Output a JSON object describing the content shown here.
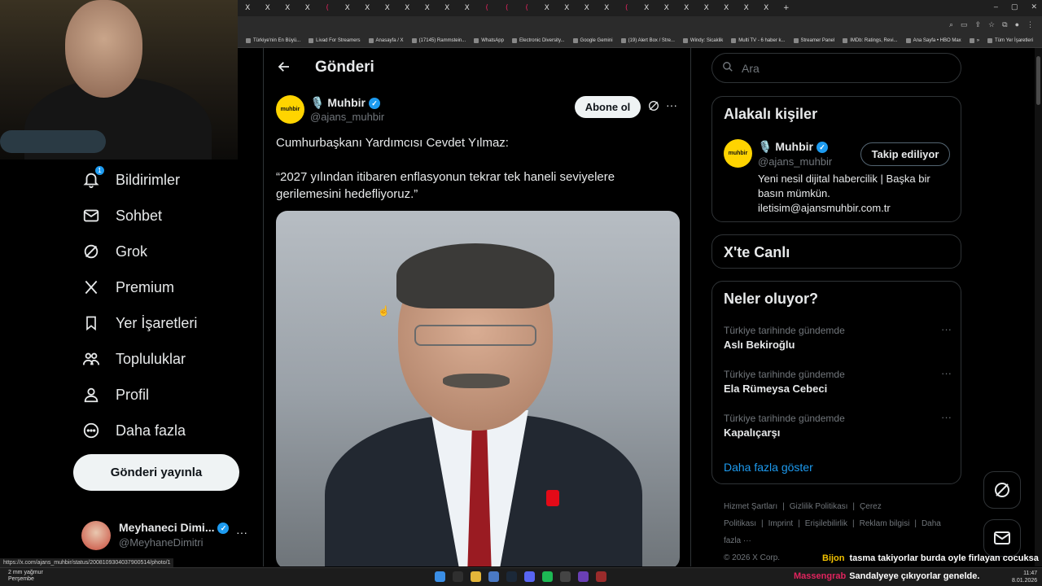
{
  "browser": {
    "tabs": [
      "X",
      "X",
      "X",
      "X",
      "(",
      "X",
      "X",
      "X",
      "X",
      "X",
      "X",
      "X",
      "(",
      "(",
      "(",
      "X",
      "X",
      "X",
      "X",
      "(",
      "X",
      "X",
      "X",
      "X",
      "X",
      "X",
      "X"
    ],
    "new_tab": "+",
    "bookmarks": [
      "Türkiye'nin En Büyü...",
      "Livad For Streamers",
      "Anasayfa / X",
      "(17145) Rammstein...",
      "WhatsApp",
      "Electronic Diversity...",
      "Google Gemini",
      "(19) Alert Box / Stre...",
      "Windy: Sicaklik",
      "Multi TV - 6 haber k...",
      "Streamer Panel",
      "IMDb: Ratings, Revi...",
      "Ana Sayfa • HBO Max",
      "»",
      "Tüm Yer İşaretleri"
    ],
    "status_url": "https://x.com/ajans_muhbir/status/2008109304037900514/photo/1"
  },
  "nav": {
    "notifications": {
      "label": "Bildirimler",
      "badge": "1"
    },
    "messages": "Sohbet",
    "grok": "Grok",
    "premium": "Premium",
    "bookmarks": "Yer İşaretleri",
    "communities": "Topluluklar",
    "profile": "Profil",
    "more": "Daha fazla",
    "post_button": "Gönderi yayınla",
    "account": {
      "name": "Meyhaneci Dimi...",
      "handle": "@MeyhaneDimitri",
      "more": "···"
    }
  },
  "main": {
    "title": "Gönderi",
    "author": {
      "name": "🎙️ Muhbir",
      "handle": "@ajans_muhbir",
      "avatar_text": "muhbir"
    },
    "subscribe": "Abone ol",
    "more": "···",
    "text_line1": "Cumhurbaşkanı Yardımcısı Cevdet Yılmaz:",
    "text_line2": "“2027 yılından itibaren enflasyonun tekrar tek haneli seviyelere gerilemesini hedefliyoruz.”"
  },
  "sidebar": {
    "search_placeholder": "Ara",
    "relevant": {
      "title": "Alakalı kişiler",
      "name": "🎙️ Muhbir",
      "handle": "@ajans_muhbir",
      "avatar_text": "muhbir",
      "following_button": "Takip ediliyor",
      "bio": "Yeni nesil dijital habercilik | Başka bir basın mümkün. iletisim@ajansmuhbir.com.tr"
    },
    "live": {
      "title": "X'te Canlı"
    },
    "trends": {
      "title": "Neler oluyor?",
      "items": [
        {
          "context": "Türkiye tarihinde gündemde",
          "name": "Aslı Bekiroğlu"
        },
        {
          "context": "Türkiye tarihinde gündemde",
          "name": "Ela Rümeysa Cebeci"
        },
        {
          "context": "Türkiye tarihinde gündemde",
          "name": "Kapalıçarşı"
        }
      ],
      "show_more": "Daha fazla göster"
    },
    "footer": {
      "links": [
        "Hizmet Şartları",
        "|",
        "Gizlilik Politikası",
        "|",
        "Çerez Politikası",
        "|",
        "Imprint",
        "|",
        "Erişilebilirlik",
        "|",
        "Reklam bilgisi",
        "|",
        "Daha fazla ···"
      ],
      "copyright": "© 2026 X Corp."
    }
  },
  "overlay": {
    "chat1_user": "Bijon",
    "chat1_text": "tasma takiyorlar burda oyle firlayan cocuksa",
    "chat2_user": "Massengrab",
    "chat2_text": "Sandalyeye çıkıyorlar genelde."
  },
  "taskbar": {
    "weather_temp": "2 mm yağmur",
    "weather_day": "Perşembe",
    "time": "11:47",
    "date": "8.01.2026"
  },
  "colors": {
    "accent": "#1d9bf0",
    "muhbir_yellow": "#ffd400",
    "chat_user1": "#f2c200",
    "chat_user2": "#e0245e"
  }
}
